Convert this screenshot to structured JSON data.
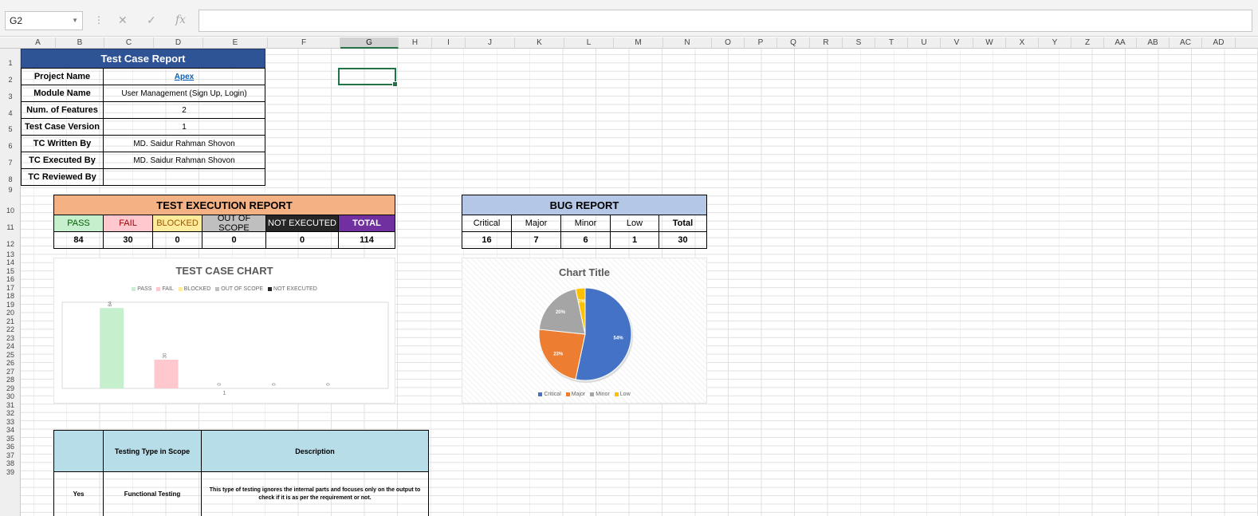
{
  "formula_bar": {
    "name_box": "G2",
    "formula": ""
  },
  "columns": [
    "A",
    "B",
    "C",
    "D",
    "E",
    "F",
    "G",
    "H",
    "I",
    "J",
    "K",
    "L",
    "M",
    "N",
    "O",
    "P",
    "Q",
    "R",
    "S",
    "T",
    "U",
    "V",
    "W",
    "X",
    "Y",
    "Z",
    "AA",
    "AB",
    "AC",
    "AD"
  ],
  "selected_column": "G",
  "rows": [
    "1",
    "2",
    "3",
    "4",
    "5",
    "6",
    "7",
    "8",
    "9",
    "10",
    "11",
    "12",
    "13",
    "14",
    "15",
    "16",
    "17",
    "18",
    "19",
    "20",
    "21",
    "22",
    "23",
    "24",
    "25",
    "26",
    "27",
    "28",
    "29",
    "30",
    "31",
    "32",
    "33",
    "34",
    "35",
    "36",
    "37",
    "38",
    "39"
  ],
  "report": {
    "title": "Test Case Report",
    "rows": [
      {
        "label": "Project Name",
        "value": "Apex",
        "is_link": true
      },
      {
        "label": "Module Name",
        "value": "User Management (Sign Up, Login)"
      },
      {
        "label": "Num. of Features",
        "value": "2"
      },
      {
        "label": "Test Case Version",
        "value": "1"
      },
      {
        "label": "TC Written By",
        "value": "MD. Saidur Rahman Shovon"
      },
      {
        "label": "TC Executed By",
        "value": "MD. Saidur Rahman Shovon"
      },
      {
        "label": "TC Reviewed By",
        "value": ""
      }
    ]
  },
  "execution": {
    "title": "TEST EXECUTION REPORT",
    "headers": [
      "PASS",
      "FAIL",
      "BLOCKED",
      "OUT OF SCOPE",
      "NOT EXECUTED",
      "TOTAL"
    ],
    "values": [
      "84",
      "30",
      "0",
      "0",
      "0",
      "114"
    ],
    "colors": {
      "title_bg": "#f4b183",
      "pass": "#c6efce",
      "fail": "#ffc7ce",
      "blocked": "#ffeb9c",
      "oos": "#bfbfbf",
      "notexec": "#262626",
      "total": "#7030a0"
    }
  },
  "bug": {
    "title": "BUG REPORT",
    "headers": [
      "Critical",
      "Major",
      "Minor",
      "Low",
      "Total"
    ],
    "values": [
      "16",
      "7",
      "6",
      "1",
      "30"
    ],
    "colors": {
      "title_bg": "#b4c7e7"
    }
  },
  "test_chart": {
    "title": "TEST CASE CHART",
    "x_tick": "1",
    "legend": [
      {
        "name": "PASS",
        "color": "#c6efce"
      },
      {
        "name": "FAIL",
        "color": "#ffc7ce"
      },
      {
        "name": "BLOCKED",
        "color": "#ffeb9c"
      },
      {
        "name": "OUT OF SCOPE",
        "color": "#bfbfbf"
      },
      {
        "name": "NOT EXECUTED",
        "color": "#262626"
      }
    ]
  },
  "pie_chart": {
    "title": "Chart Title",
    "legend": [
      {
        "name": "Critical",
        "color": "#4472c4"
      },
      {
        "name": "Major",
        "color": "#ed7d31"
      },
      {
        "name": "Minor",
        "color": "#a5a5a5"
      },
      {
        "name": "Low",
        "color": "#ffc000"
      }
    ]
  },
  "scope_table": {
    "headers": [
      "",
      "Testing Type in Scope",
      "Description"
    ],
    "row": {
      "col1": "Yes",
      "type": "Functional Testing",
      "description": "This type of testing ignores the internal parts and focuses only on the output to check if it is as per the requirement or not."
    },
    "header_bg": "#b7dde8"
  },
  "chart_data": [
    {
      "type": "bar",
      "title": "TEST CASE CHART",
      "categories": [
        "1"
      ],
      "series": [
        {
          "name": "PASS",
          "values": [
            84
          ]
        },
        {
          "name": "FAIL",
          "values": [
            30
          ]
        },
        {
          "name": "BLOCKED",
          "values": [
            0
          ]
        },
        {
          "name": "OUT OF SCOPE",
          "values": [
            0
          ]
        },
        {
          "name": "NOT EXECUTED",
          "values": [
            0
          ]
        }
      ],
      "ylim": [
        0,
        90
      ],
      "legend": "top"
    },
    {
      "type": "pie",
      "title": "Chart Title",
      "labels": [
        "Critical",
        "Major",
        "Minor",
        "Low"
      ],
      "values": [
        16,
        7,
        6,
        1
      ],
      "percent_labels": [
        "54%",
        "23%",
        "20%",
        "3%"
      ],
      "legend": "bottom"
    }
  ]
}
